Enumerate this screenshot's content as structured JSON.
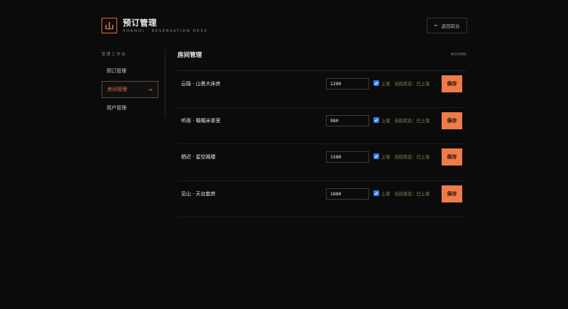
{
  "header": {
    "title": "预订管理",
    "subtitle": "SHANQI · RESERVATION DESK",
    "back_label": "返回前台",
    "logo_icon": "mountain-bars-icon",
    "accent_color": "#e0703f"
  },
  "sidebar": {
    "heading": "管理工作台",
    "items": [
      {
        "label": "预订管理",
        "active": false
      },
      {
        "label": "房间管理",
        "active": true
      },
      {
        "label": "用户管理",
        "active": false
      }
    ]
  },
  "main": {
    "title": "房间管理",
    "eyebrow": "ROOMS",
    "rooms": [
      {
        "name": "云隐 · 山景大床房",
        "price": "1280",
        "shelf_label": "上架",
        "checked": true,
        "status": "当前状态：已上架",
        "save_label": "保存"
      },
      {
        "name": "听雨 · 榻榻米茶室",
        "price": "980",
        "shelf_label": "上架",
        "checked": true,
        "status": "当前状态：已上架",
        "save_label": "保存"
      },
      {
        "name": "栖迟 · 星空阁楼",
        "price": "1580",
        "shelf_label": "上架",
        "checked": true,
        "status": "当前状态：已上架",
        "save_label": "保存"
      },
      {
        "name": "见山 · 天台套房",
        "price": "1880",
        "shelf_label": "上架",
        "checked": true,
        "status": "当前状态：已上架",
        "save_label": "保存"
      }
    ]
  },
  "colors": {
    "background": "#0b0b0b",
    "accent": "#f07b48",
    "status_green": "#7a8f62",
    "checkbox_blue": "#2f7ff0"
  }
}
